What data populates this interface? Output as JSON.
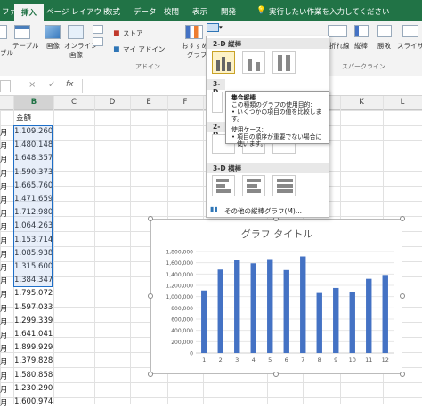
{
  "tabs": [
    {
      "label": "ファイル",
      "active": false
    },
    {
      "label": "挿入",
      "active": true
    },
    {
      "label": "ページ レイアウト",
      "active": false
    },
    {
      "label": "数式",
      "active": false
    },
    {
      "label": "データ",
      "active": false
    },
    {
      "label": "校閲",
      "active": false
    },
    {
      "label": "表示",
      "active": false
    },
    {
      "label": "開発",
      "active": false
    }
  ],
  "tell_me": "実行したい作業を入力してください",
  "ribbon": {
    "table_btn": "テーブル",
    "table_left": "ブル",
    "image_btn": "画像",
    "online_image_l1": "オンライン",
    "online_image_l2": "画像",
    "store": "ストア",
    "my_addins": "マイ アドイン",
    "addins_group": "アドイン",
    "recommend_l1": "おすすめ",
    "recommend_l2": "グラフ",
    "line_btn": "折れ線",
    "column_btn": "縦棒",
    "winloss_btn": "勝敗",
    "sparkline_group": "スパークライン",
    "slicer_btn": "スライサー"
  },
  "formula_bar": {
    "cancel": "×",
    "enter": "✓",
    "fx": "fx",
    "value": ""
  },
  "columns": [
    "B",
    "C",
    "D",
    "E",
    "F",
    "G",
    "H",
    "I",
    "J",
    "K",
    "L"
  ],
  "sheet": {
    "header_b": "金額",
    "rows": [
      {
        "a": "月",
        "b": "1,109,260"
      },
      {
        "a": "月",
        "b": "1,480,148"
      },
      {
        "a": "月",
        "b": "1,648,357"
      },
      {
        "a": "月",
        "b": "1,590,373"
      },
      {
        "a": "月",
        "b": "1,665,760"
      },
      {
        "a": "月",
        "b": "1,471,659"
      },
      {
        "a": "月",
        "b": "1,712,980"
      },
      {
        "a": "月",
        "b": "1,064,263"
      },
      {
        "a": "月",
        "b": "1,153,714"
      },
      {
        "a": "月",
        "b": "1,085,938"
      },
      {
        "a": "月",
        "b": "1,315,600"
      },
      {
        "a": "月",
        "b": "1,384,347"
      },
      {
        "a": "月",
        "b": "1,795,072"
      },
      {
        "a": "月",
        "b": "1,597,033"
      },
      {
        "a": "月",
        "b": "1,299,339"
      },
      {
        "a": "月",
        "b": "1,641,041"
      },
      {
        "a": "月",
        "b": "1,899,929"
      },
      {
        "a": "月",
        "b": "1,379,828"
      },
      {
        "a": "月",
        "b": "1,580,858"
      },
      {
        "a": "月",
        "b": "1,230,290"
      },
      {
        "a": "月",
        "b": "1,600,974"
      }
    ]
  },
  "dropdown": {
    "sec_2d": "2-D 縦棒",
    "sec_3d_partial": "3-D",
    "sec_2d_bar_partial": "2-D",
    "sec_3d_bar": "3-D 横棒",
    "more_link": "その他の縦棒グラフ(M)..."
  },
  "tooltip": {
    "title": "集合縦棒",
    "line1": "この種類のグラフの使用目的:",
    "line2": "• いくつかの項目の値を比較します。",
    "line3": "使用ケース:",
    "line4": "• 項目の順序が重要でない場合に",
    "line5": "使います。"
  },
  "chart_data": {
    "type": "bar",
    "title": "グラフ タイトル",
    "categories": [
      "1",
      "2",
      "3",
      "4",
      "5",
      "6",
      "7",
      "8",
      "9",
      "10",
      "11",
      "12"
    ],
    "values": [
      1109260,
      1480148,
      1648357,
      1590373,
      1665760,
      1471659,
      1712980,
      1064263,
      1153714,
      1085938,
      1315600,
      1384347
    ],
    "ylim": [
      0,
      1800000
    ],
    "yticks": [
      "0",
      "200,000",
      "400,000",
      "600,000",
      "800,000",
      "1,000,000",
      "1,200,000",
      "1,400,000",
      "1,600,000",
      "1,800,000"
    ],
    "bar_color": "#4472c4",
    "grid": true
  },
  "colors": {
    "excel_green": "#217346",
    "selection_blue": "#1e6fc8"
  }
}
